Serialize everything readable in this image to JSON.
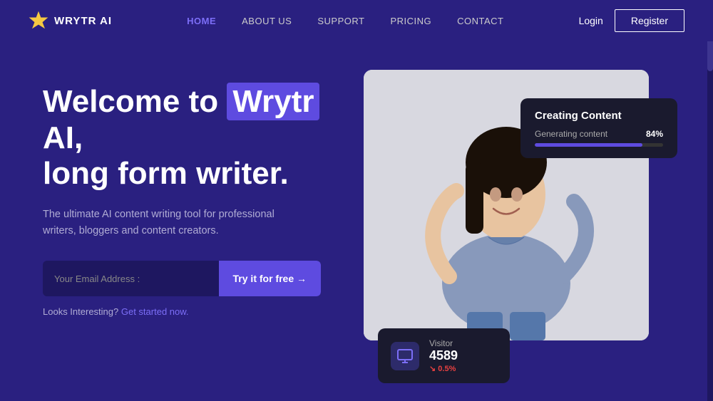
{
  "brand": {
    "name": "WRYTR AI",
    "logo_icon": "star"
  },
  "navbar": {
    "links": [
      {
        "label": "HOME",
        "active": true
      },
      {
        "label": "ABOUT US",
        "active": false
      },
      {
        "label": "SUPPORT",
        "active": false
      },
      {
        "label": "PRICING",
        "active": false
      },
      {
        "label": "CONTACT",
        "active": false
      }
    ],
    "login_label": "Login",
    "register_label": "Register"
  },
  "hero": {
    "title_part1": "Welcome to ",
    "title_highlight": "Wrytr",
    "title_part2": " AI,",
    "title_line2": "long form writer.",
    "subtitle": "The ultimate AI content writing tool for professional writers, bloggers and content creators.",
    "email_placeholder": "Your Email Address :",
    "cta_button": "Try it for free →",
    "looks_interesting": "Looks Interesting?",
    "get_started": "Get started now."
  },
  "creating_content_card": {
    "title": "Creating Content",
    "label": "Generating content",
    "percent": "84%",
    "progress": 84
  },
  "visitor_card": {
    "label": "Visitor",
    "count": "4589",
    "change": "↘ 0.5%"
  },
  "colors": {
    "bg": "#2a2080",
    "accent": "#5e4be0",
    "card_bg": "#1a1a2e"
  }
}
